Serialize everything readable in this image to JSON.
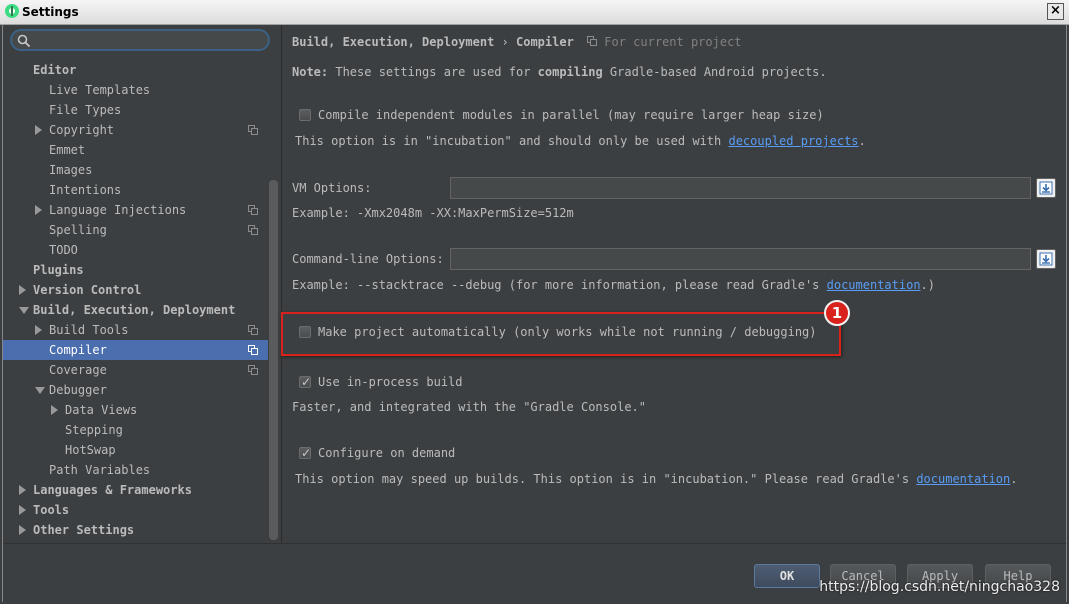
{
  "window": {
    "title": "Settings",
    "close": "×"
  },
  "search": {
    "value": "",
    "placeholder": ""
  },
  "tree": [
    {
      "label": "Editor",
      "level": 0,
      "bold": true,
      "arrow": "none"
    },
    {
      "label": "Live Templates",
      "level": 1
    },
    {
      "label": "File Types",
      "level": 1
    },
    {
      "label": "Copyright",
      "level": 1,
      "arrow": "right",
      "project": true
    },
    {
      "label": "Emmet",
      "level": 1
    },
    {
      "label": "Images",
      "level": 1
    },
    {
      "label": "Intentions",
      "level": 1
    },
    {
      "label": "Language Injections",
      "level": 1,
      "arrow": "right",
      "project": true
    },
    {
      "label": "Spelling",
      "level": 1,
      "project": true
    },
    {
      "label": "TODO",
      "level": 1
    },
    {
      "label": "Plugins",
      "level": 0,
      "bold": true
    },
    {
      "label": "Version Control",
      "level": 0,
      "bold": true,
      "arrow": "right"
    },
    {
      "label": "Build, Execution, Deployment",
      "level": 0,
      "bold": true,
      "arrow": "down"
    },
    {
      "label": "Build Tools",
      "level": 1,
      "arrow": "right",
      "project": true
    },
    {
      "label": "Compiler",
      "level": 1,
      "selected": true,
      "project": true
    },
    {
      "label": "Coverage",
      "level": 1,
      "project": true
    },
    {
      "label": "Debugger",
      "level": 1,
      "arrow": "down"
    },
    {
      "label": "Data Views",
      "level": 2,
      "arrow": "right"
    },
    {
      "label": "Stepping",
      "level": 2
    },
    {
      "label": "HotSwap",
      "level": 2
    },
    {
      "label": "Path Variables",
      "level": 1
    },
    {
      "label": "Languages & Frameworks",
      "level": 0,
      "bold": true,
      "arrow": "right"
    },
    {
      "label": "Tools",
      "level": 0,
      "bold": true,
      "arrow": "right"
    },
    {
      "label": "Other Settings",
      "level": 0,
      "bold": true,
      "arrow": "right"
    }
  ],
  "breadcrumb": {
    "parent": "Build, Execution, Deployment",
    "separator": "›",
    "current": "Compiler",
    "scope": "For current project"
  },
  "note": {
    "prefix": "Note:",
    "text1": " These settings are used for ",
    "bold": "compiling",
    "text2": " Gradle-based Android projects."
  },
  "parallel": {
    "label": "Compile independent modules in parallel (may require larger heap size)",
    "checked": false,
    "hint": "This option is in \"incubation\" and should only be used with ",
    "link": "decoupled projects",
    "hint_end": "."
  },
  "vm_options": {
    "label": "VM Options:",
    "value": "",
    "example": "Example: -Xmx2048m -XX:MaxPermSize=512m"
  },
  "cmd_options": {
    "label": "Command-line Options:",
    "value": "",
    "example": "Example: --stacktrace --debug (for more information, please read Gradle's ",
    "link": "documentation",
    "example_end": ".)"
  },
  "make_auto": {
    "label": "Make project automatically (only works while not running / debugging)",
    "checked": false,
    "badge": "1"
  },
  "in_process": {
    "label": "Use in-process build",
    "checked": true,
    "hint": "Faster, and integrated with the \"Gradle Console.\""
  },
  "on_demand": {
    "label": "Configure on demand",
    "checked": true,
    "hint": "This option may speed up builds. This option is in \"incubation.\" Please read Gradle's ",
    "link": "documentation",
    "hint_end": "."
  },
  "buttons": {
    "ok": "OK",
    "cancel": "Cancel",
    "apply": "Apply",
    "help": "Help"
  },
  "watermark": "https://blog.csdn.net/ningchao328",
  "colors": {
    "background": "#3c3f41",
    "selection": "#4b6eaf",
    "link": "#589df6",
    "highlight": "#d9221c"
  }
}
